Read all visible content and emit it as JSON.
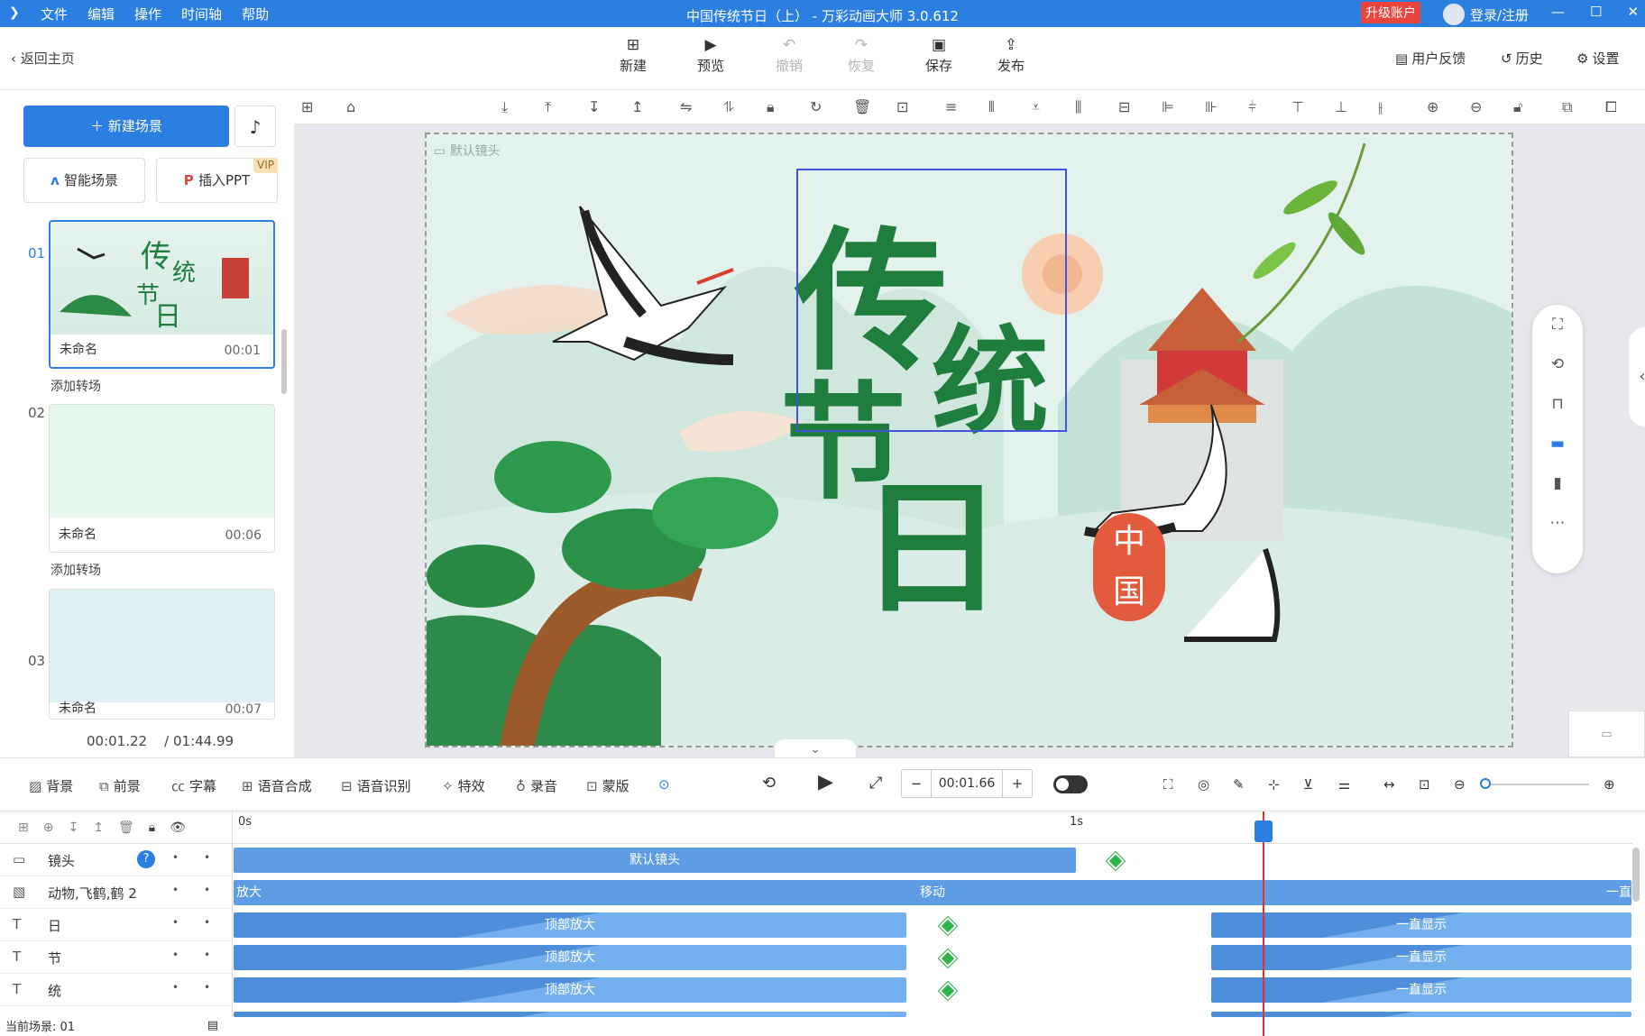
{
  "titlebar": {
    "menus": [
      "文件",
      "编辑",
      "操作",
      "时间轴",
      "帮助"
    ],
    "title": "中国传统节日（上） - 万彩动画大师 3.0.612",
    "upgrade": "升级账户",
    "login": "登录/注册",
    "brand_color": "#2a7fe0"
  },
  "toolbar": {
    "back": "返回主页",
    "new": "新建",
    "preview": "预览",
    "undo": "撤销",
    "redo": "恢复",
    "save": "保存",
    "publish": "发布",
    "feedback": "用户反馈",
    "history": "历史",
    "settings": "设置"
  },
  "left": {
    "new_scene": "新建场景",
    "smart_scene": "智能场景",
    "insert_ppt": "插入PPT",
    "vip": "VIP",
    "add_transition": "添加转场",
    "scenes": [
      {
        "no": "01",
        "name": "未命名",
        "duration": "00:01"
      },
      {
        "no": "02",
        "name": "未命名",
        "duration": "00:06"
      },
      {
        "no": "03",
        "name": "未命名",
        "duration": "00:07"
      }
    ],
    "current_time": "00:01.22",
    "total_time": "/ 01:44.99"
  },
  "canvas": {
    "camera_label": "默认镜头",
    "chars": [
      "传",
      "统",
      "节",
      "日"
    ],
    "seal": [
      "中",
      "国"
    ]
  },
  "timeline_tools": {
    "background": "背景",
    "foreground": "前景",
    "subtitle": "字幕",
    "tts": "语音合成",
    "asr": "语音识别",
    "effects": "特效",
    "record": "录音",
    "mask": "蒙版",
    "time": "00:01.66",
    "minus": "−",
    "plus": "+"
  },
  "timeline": {
    "ruler": [
      "0s",
      "1s"
    ],
    "tracks": [
      {
        "name": "镜头",
        "bars": [
          "默认镜头"
        ]
      },
      {
        "name": "动物,飞鹤,鹤 2",
        "bars": [
          "放大",
          "移动",
          "一直"
        ]
      },
      {
        "name": "日",
        "bars": [
          "顶部放大",
          "一直显示"
        ]
      },
      {
        "name": "节",
        "bars": [
          "顶部放大",
          "一直显示"
        ]
      },
      {
        "name": "统",
        "bars": [
          "顶部放大",
          "一直显示"
        ]
      }
    ],
    "current_scene": "当前场景: 01"
  }
}
